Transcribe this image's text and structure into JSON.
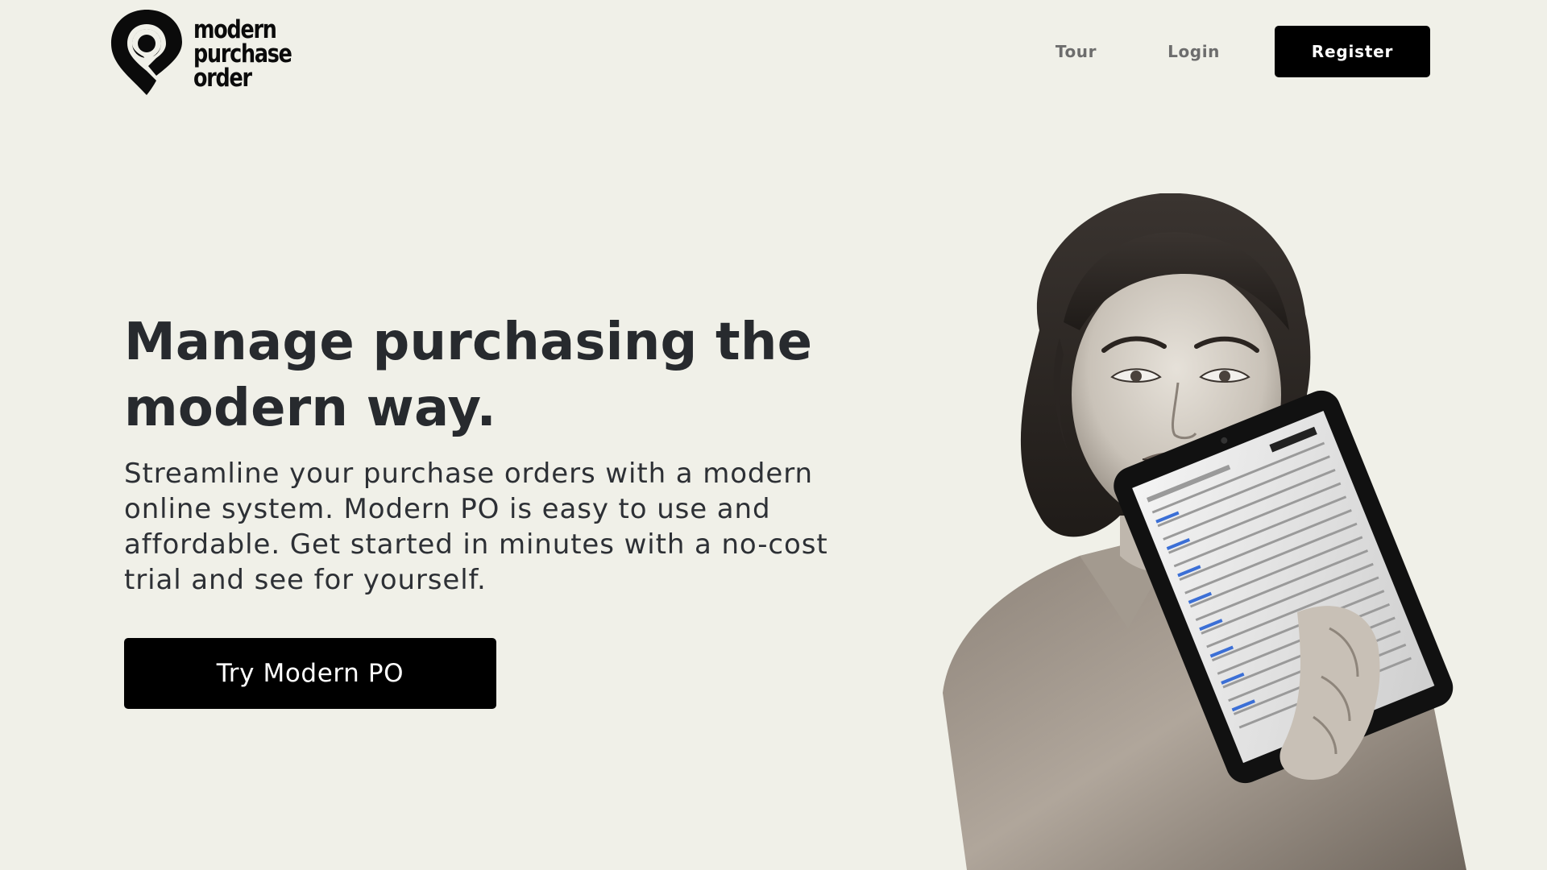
{
  "header": {
    "logo": {
      "line1": "modern",
      "line2": "purchase",
      "line3": "order",
      "icon": "map-pin-logo-icon"
    },
    "nav": {
      "tour_label": "Tour",
      "login_label": "Login",
      "register_label": "Register"
    }
  },
  "hero": {
    "title": "Manage purchasing the modern way.",
    "subtitle": "Streamline your purchase orders with a modern online system. Modern PO is easy to use and affordable. Get started in minutes with a no-cost trial and see for yourself.",
    "cta_label": "Try Modern PO",
    "image": "woman-holding-tablet-photo"
  },
  "colors": {
    "background": "#f0f0e8",
    "text": "#272a2e",
    "button": "#000000",
    "button_text": "#ffffff",
    "nav_link": "#6d6d6d"
  }
}
